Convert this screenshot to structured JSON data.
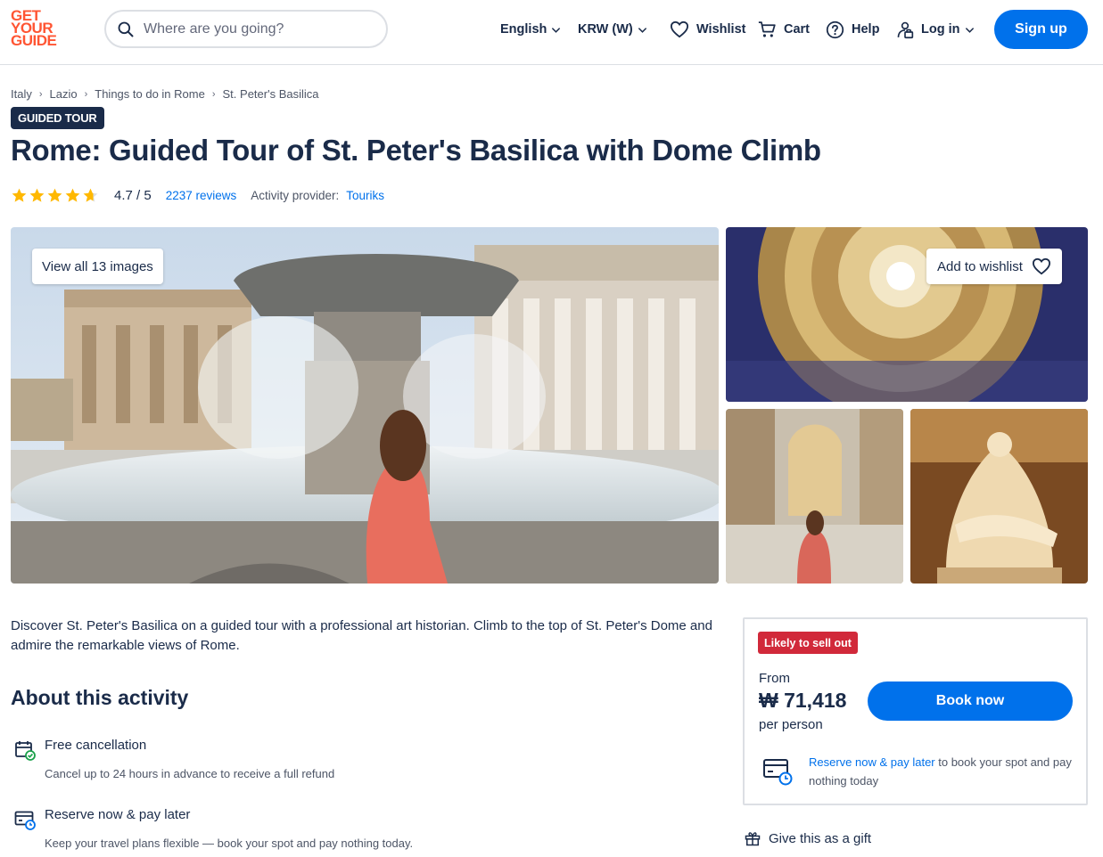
{
  "header": {
    "logo_lines": [
      "GET",
      "YOUR",
      "GUIDE"
    ],
    "search_placeholder": "Where are you going?",
    "nav": {
      "language": "English",
      "currency": "KRW (W)",
      "wishlist": "Wishlist",
      "cart": "Cart",
      "help": "Help",
      "login": "Log in"
    },
    "signup": "Sign up"
  },
  "breadcrumb": [
    "Italy",
    "Lazio",
    "Things to do in Rome",
    "St. Peter's Basilica"
  ],
  "badge": "GUIDED TOUR",
  "title": "Rome: Guided Tour of St. Peter's Basilica with Dome Climb",
  "rating": {
    "value": "4.7 / 5",
    "stars": 4.7,
    "reviews": "2237 reviews",
    "provider_label": "Activity provider:",
    "provider": "Touriks"
  },
  "gallery": {
    "view_all": "View all 13 images",
    "add_to_wishlist": "Add to wishlist"
  },
  "description": "Discover St. Peter's Basilica on a guided tour with a professional art historian. Climb to the top of St. Peter's Dome and admire the remarkable views of Rome.",
  "about": {
    "title": "About this activity",
    "features": [
      {
        "title": "Free cancellation",
        "desc": "Cancel up to 24 hours in advance to receive a full refund",
        "icon": "calendar-check-icon"
      },
      {
        "title": "Reserve now & pay later",
        "desc": "Keep your travel plans flexible — book your spot and pay nothing today.",
        "icon": "card-clock-icon"
      }
    ]
  },
  "booking": {
    "badge": "Likely to sell out",
    "from": "From",
    "price": "₩ 71,418",
    "per": "per person",
    "button": "Book now",
    "reserve_link": "Reserve now & pay later",
    "reserve_rest": " to book your spot and pay nothing today"
  },
  "gift": "Give this as a gift",
  "colors": {
    "brand": "#ff5533",
    "primary": "#0071eb",
    "navy": "#1a2b49",
    "alert": "#d1293a",
    "star": "#ffb800"
  }
}
